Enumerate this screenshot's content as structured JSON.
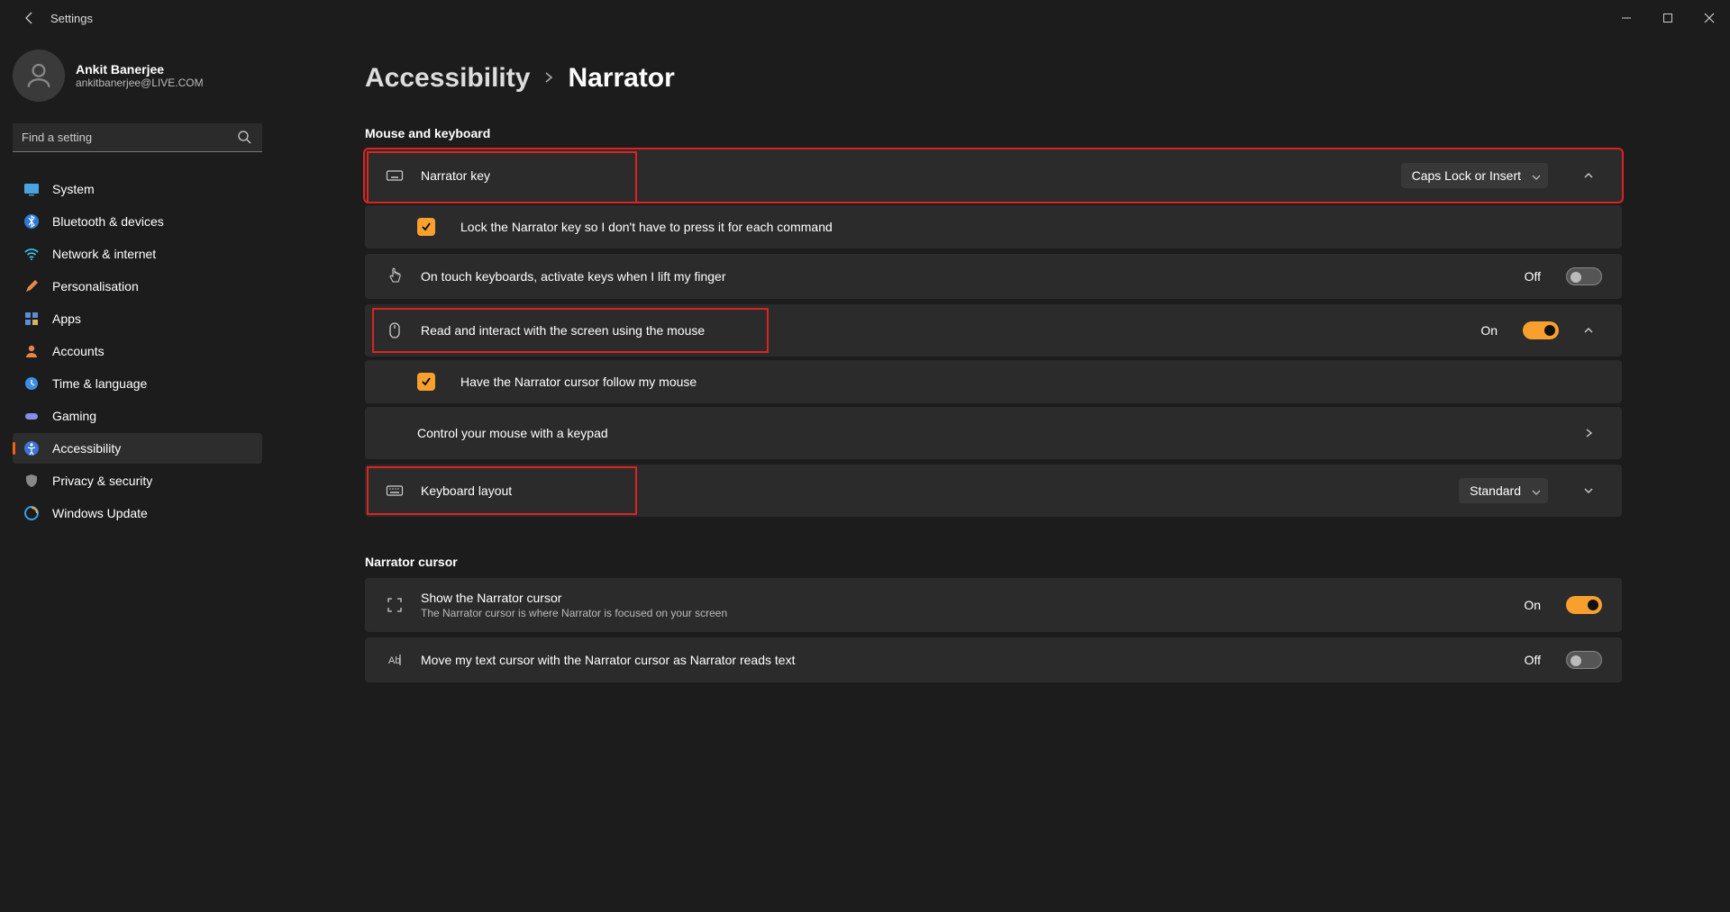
{
  "window": {
    "title": "Settings"
  },
  "user": {
    "name": "Ankit Banerjee",
    "email": "ankitbanerjee@LIVE.COM"
  },
  "search": {
    "placeholder": "Find a setting"
  },
  "nav": {
    "items": [
      {
        "label": "System"
      },
      {
        "label": "Bluetooth & devices"
      },
      {
        "label": "Network & internet"
      },
      {
        "label": "Personalisation"
      },
      {
        "label": "Apps"
      },
      {
        "label": "Accounts"
      },
      {
        "label": "Time & language"
      },
      {
        "label": "Gaming"
      },
      {
        "label": "Accessibility"
      },
      {
        "label": "Privacy & security"
      },
      {
        "label": "Windows Update"
      }
    ]
  },
  "breadcrumb": {
    "parent": "Accessibility",
    "current": "Narrator"
  },
  "sections": {
    "mouseKeyboard": {
      "label": "Mouse and keyboard",
      "narratorKey": {
        "title": "Narrator key",
        "selected": "Caps Lock or Insert"
      },
      "lockKey": {
        "label": "Lock the Narrator key so I don't have to press it for each command"
      },
      "touchKeyboards": {
        "label": "On touch keyboards, activate keys when I lift my finger",
        "state": "Off"
      },
      "readMouse": {
        "title": "Read and interact with the screen using the mouse",
        "state": "On"
      },
      "cursorFollow": {
        "label": "Have the Narrator cursor follow my mouse"
      },
      "keypad": {
        "label": "Control your mouse with a keypad"
      },
      "keyboardLayout": {
        "title": "Keyboard layout",
        "selected": "Standard"
      }
    },
    "narratorCursor": {
      "label": "Narrator cursor",
      "showCursor": {
        "title": "Show the Narrator cursor",
        "subtitle": "The Narrator cursor is where Narrator is focused on your screen",
        "state": "On"
      },
      "moveText": {
        "title": "Move my text cursor with the Narrator cursor as Narrator reads text",
        "state": "Off"
      }
    }
  }
}
